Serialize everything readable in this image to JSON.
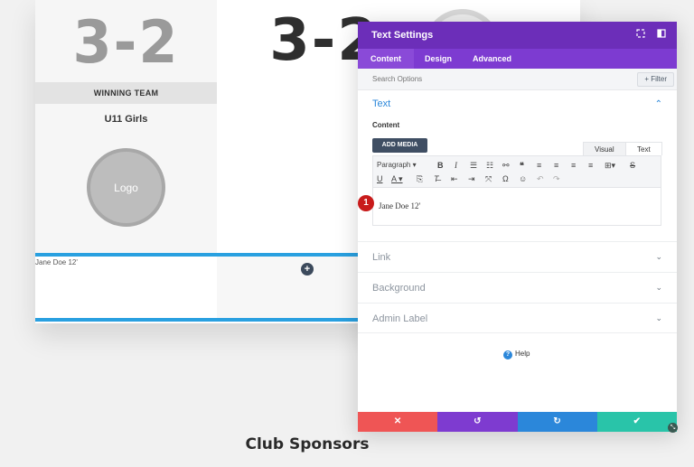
{
  "background_page": {
    "score_left": "3-2",
    "score_center": "3-2",
    "winning_team_label": "WINNING TEAM",
    "team_name": "U11 Girls",
    "logo_label": "Logo",
    "jane_text": "Jane Doe 12'",
    "section_title": "Club Sponsors"
  },
  "modal": {
    "title": "Text Settings",
    "tabs": [
      {
        "label": "Content",
        "active": true
      },
      {
        "label": "Design",
        "active": false
      },
      {
        "label": "Advanced",
        "active": false
      }
    ],
    "search": {
      "placeholder": "Search Options"
    },
    "filter_label": "+ Filter",
    "text_section": {
      "heading": "Text",
      "content_label": "Content",
      "add_media_label": "ADD MEDIA",
      "visual_tab": "Visual",
      "text_tab": "Text",
      "paragraph_select": "Paragraph",
      "editor_value": "Jane Doe 12'",
      "step_badge": "1"
    },
    "sections": [
      {
        "label": "Link"
      },
      {
        "label": "Background"
      },
      {
        "label": "Admin Label"
      }
    ],
    "help_label": "Help",
    "footer_colors": {
      "cancel": "#ef5555",
      "undo": "#7e3bd0",
      "redo": "#2b87da",
      "save": "#29c4a9"
    }
  },
  "colors": {
    "accent_purple": "#6c2eb9",
    "accent_blue": "#29a0e0"
  }
}
